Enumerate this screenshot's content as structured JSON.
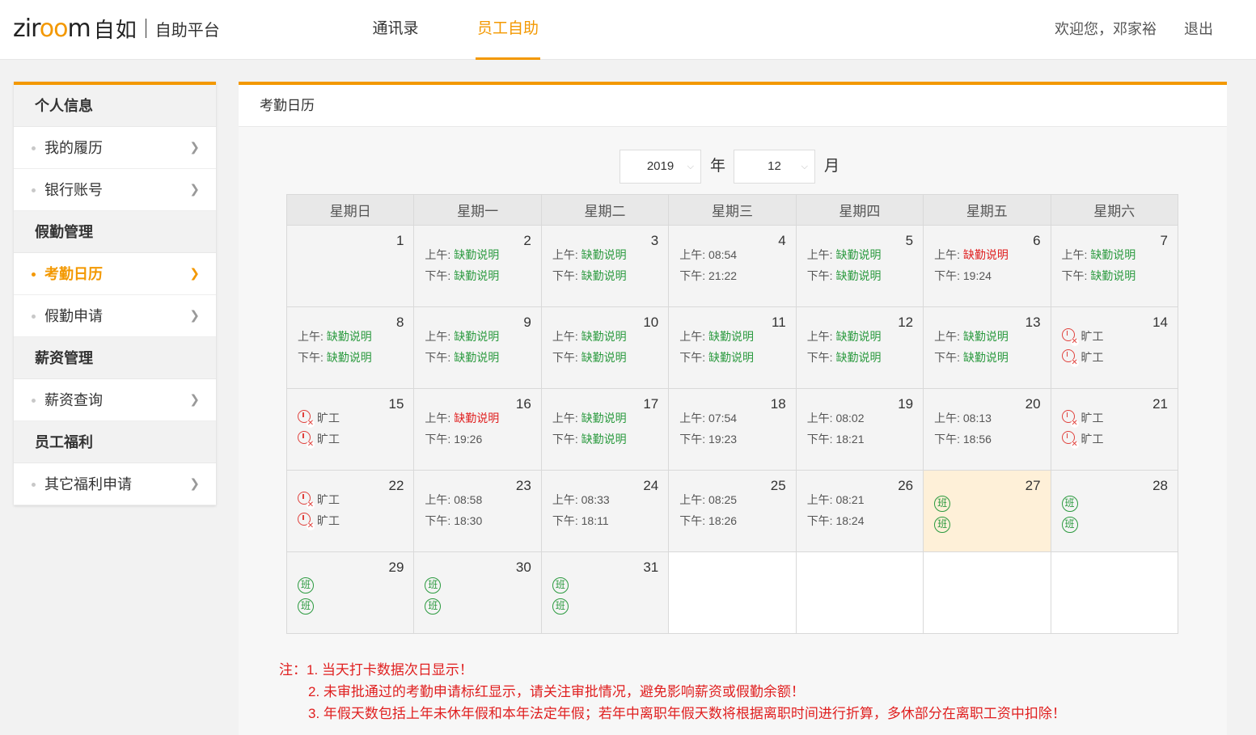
{
  "header": {
    "logo_text": "ziroom",
    "logo_cn": "自如",
    "platform": "自助平台",
    "nav": [
      "通讯录",
      "员工自助"
    ],
    "welcome": "欢迎您，邓家裕",
    "logout": "退出"
  },
  "sidebar": {
    "groups": [
      {
        "title": "个人信息",
        "items": [
          "我的履历",
          "银行账号"
        ]
      },
      {
        "title": "假勤管理",
        "items": [
          "考勤日历",
          "假勤申请"
        ]
      },
      {
        "title": "薪资管理",
        "items": [
          "薪资查询"
        ]
      },
      {
        "title": "员工福利",
        "items": [
          "其它福利申请"
        ]
      }
    ],
    "active_item": "考勤日历"
  },
  "panel": {
    "title": "考勤日历",
    "year": "2019",
    "year_label": "年",
    "month": "12",
    "month_label": "月"
  },
  "calendar": {
    "weekdays": [
      "星期日",
      "星期一",
      "星期二",
      "星期三",
      "星期四",
      "星期五",
      "星期六"
    ],
    "am_label": "上午:",
    "pm_label": "下午:",
    "absent_label": "旷工",
    "shift_label": "班",
    "missing_label": "缺勤说明",
    "weeks": [
      [
        {
          "day": "1",
          "kind": "blank"
        },
        {
          "day": "2",
          "am": "缺勤说明",
          "pm": "缺勤说明"
        },
        {
          "day": "3",
          "am": "缺勤说明",
          "pm": "缺勤说明"
        },
        {
          "day": "4",
          "am": "08:54",
          "pm": "21:22"
        },
        {
          "day": "5",
          "am": "缺勤说明",
          "pm": "缺勤说明"
        },
        {
          "day": "6",
          "am": "缺勤说明",
          "am_red": true,
          "pm": "19:24"
        },
        {
          "day": "7",
          "am": "缺勤说明",
          "pm": "缺勤说明"
        }
      ],
      [
        {
          "day": "8",
          "am": "缺勤说明",
          "pm": "缺勤说明"
        },
        {
          "day": "9",
          "am": "缺勤说明",
          "pm": "缺勤说明"
        },
        {
          "day": "10",
          "am": "缺勤说明",
          "pm": "缺勤说明"
        },
        {
          "day": "11",
          "am": "缺勤说明",
          "pm": "缺勤说明"
        },
        {
          "day": "12",
          "am": "缺勤说明",
          "pm": "缺勤说明"
        },
        {
          "day": "13",
          "am": "缺勤说明",
          "pm": "缺勤说明"
        },
        {
          "day": "14",
          "kind": "absent"
        }
      ],
      [
        {
          "day": "15",
          "kind": "absent"
        },
        {
          "day": "16",
          "am": "缺勤说明",
          "am_red": true,
          "pm": "19:26"
        },
        {
          "day": "17",
          "am": "缺勤说明",
          "pm": "缺勤说明"
        },
        {
          "day": "18",
          "am": "07:54",
          "pm": "19:23"
        },
        {
          "day": "19",
          "am": "08:02",
          "pm": "18:21"
        },
        {
          "day": "20",
          "am": "08:13",
          "pm": "18:56"
        },
        {
          "day": "21",
          "kind": "absent"
        }
      ],
      [
        {
          "day": "22",
          "kind": "absent"
        },
        {
          "day": "23",
          "am": "08:58",
          "pm": "18:30"
        },
        {
          "day": "24",
          "am": "08:33",
          "pm": "18:11"
        },
        {
          "day": "25",
          "am": "08:25",
          "pm": "18:26"
        },
        {
          "day": "26",
          "am": "08:21",
          "pm": "18:24"
        },
        {
          "day": "27",
          "kind": "shift",
          "today": true
        },
        {
          "day": "28",
          "kind": "shift"
        }
      ],
      [
        {
          "day": "29",
          "kind": "shift"
        },
        {
          "day": "30",
          "kind": "shift"
        },
        {
          "day": "31",
          "kind": "shift"
        },
        {
          "kind": "empty"
        },
        {
          "kind": "empty"
        },
        {
          "kind": "empty"
        },
        {
          "kind": "empty"
        }
      ]
    ]
  },
  "notes": [
    "注：1. 当天打卡数据次日显示！",
    "2. 未审批通过的考勤申请标红显示，请关注审批情况，避免影响薪资或假勤余额！",
    "3. 年假天数包括上年未休年假和本年法定年假；若年中离职年假天数将根据离职时间进行折算，多休部分在离职工资中扣除！"
  ],
  "colors": {
    "accent": "#f39800",
    "ok_green": "#2b9a3f",
    "warn_red": "#e02020",
    "today_bg": "#fef0d8"
  },
  "icons": {
    "absent": "absent-clock-icon",
    "shift": "shift-icon",
    "chevron": "chevron-right-icon",
    "select_caret": "chevron-down-icon"
  }
}
